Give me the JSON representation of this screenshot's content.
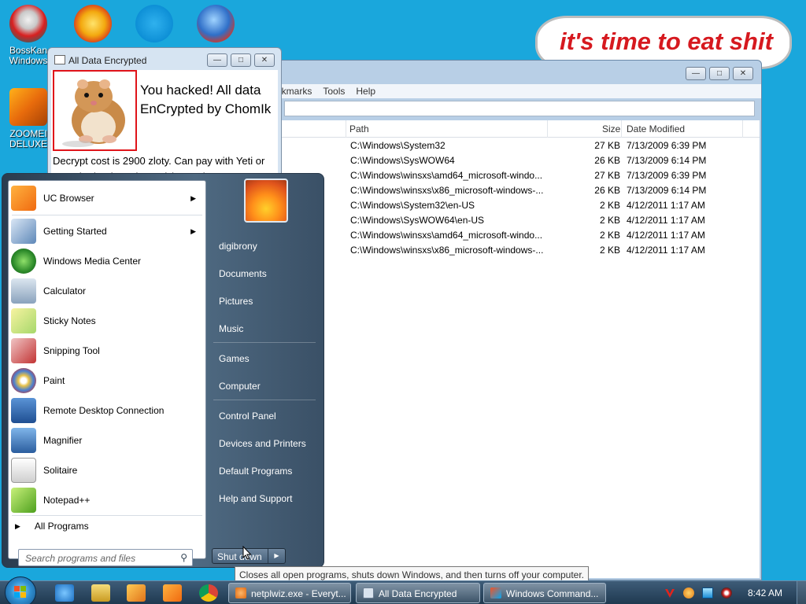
{
  "desktop": {
    "icons": [
      {
        "label": "BossKan Windows"
      },
      {
        "label": ""
      },
      {
        "label": ""
      },
      {
        "label": ""
      },
      {
        "label": "ZOOMEI DELUXE"
      }
    ],
    "bubble_text": "it's time to eat shit"
  },
  "ransom_window": {
    "title": "All Data Encrypted",
    "headline": "You hacked! All data EnCrypted by ChomIk",
    "body": "Decrypt cost is 2900 zloty. Can pay with Yeti or SMS (Poland number only). Send message"
  },
  "explorer": {
    "menu": [
      "okmarks",
      "Tools",
      "Help"
    ],
    "columns": {
      "path": "Path",
      "size": "Size",
      "date": "Date Modified"
    },
    "rows": [
      {
        "path": "C:\\Windows\\System32",
        "size": "27 KB",
        "date": "7/13/2009 6:39 PM"
      },
      {
        "path": "C:\\Windows\\SysWOW64",
        "size": "26 KB",
        "date": "7/13/2009 6:14 PM"
      },
      {
        "path": "C:\\Windows\\winsxs\\amd64_microsoft-windo...",
        "size": "27 KB",
        "date": "7/13/2009 6:39 PM"
      },
      {
        "path": "C:\\Windows\\winsxs\\x86_microsoft-windows-...",
        "size": "26 KB",
        "date": "7/13/2009 6:14 PM"
      },
      {
        "path": "C:\\Windows\\System32\\en-US",
        "size": "2 KB",
        "date": "4/12/2011 1:17 AM"
      },
      {
        "path": "C:\\Windows\\SysWOW64\\en-US",
        "size": "2 KB",
        "date": "4/12/2011 1:17 AM"
      },
      {
        "path": "C:\\Windows\\winsxs\\amd64_microsoft-windo...",
        "size": "2 KB",
        "date": "4/12/2011 1:17 AM"
      },
      {
        "path": "C:\\Windows\\winsxs\\x86_microsoft-windows-...",
        "size": "2 KB",
        "date": "4/12/2011 1:17 AM"
      }
    ]
  },
  "start_menu": {
    "programs": [
      {
        "label": "UC Browser",
        "icon": "uc-browser-icon"
      },
      {
        "label": "Getting Started",
        "icon": "getting-started-icon"
      },
      {
        "label": "Windows Media Center",
        "icon": "media-center-icon"
      },
      {
        "label": "Calculator",
        "icon": "calculator-icon"
      },
      {
        "label": "Sticky Notes",
        "icon": "sticky-notes-icon"
      },
      {
        "label": "Snipping Tool",
        "icon": "snipping-tool-icon"
      },
      {
        "label": "Paint",
        "icon": "paint-icon"
      },
      {
        "label": "Remote Desktop Connection",
        "icon": "remote-desktop-icon"
      },
      {
        "label": "Magnifier",
        "icon": "magnifier-icon"
      },
      {
        "label": "Solitaire",
        "icon": "solitaire-icon"
      },
      {
        "label": "Notepad++",
        "icon": "notepadpp-icon"
      }
    ],
    "all_programs": "All Programs",
    "search_placeholder": "Search programs and files",
    "right": {
      "user": "digibrony",
      "documents": "Documents",
      "pictures": "Pictures",
      "music": "Music",
      "games": "Games",
      "computer": "Computer",
      "control_panel": "Control Panel",
      "devices": "Devices and Printers",
      "default_programs": "Default Programs",
      "help": "Help and Support"
    },
    "shutdown_label": "Shut down",
    "tooltip": "Closes all open programs, shuts down Windows, and then turns off your computer."
  },
  "taskbar": {
    "tasks": [
      {
        "label": "netplwiz.exe - Everyt..."
      },
      {
        "label": "All Data Encrypted"
      },
      {
        "label": "Windows Command..."
      }
    ],
    "clock": "8:42 AM"
  },
  "colors": {
    "desktop_bg": "#1aa7dc",
    "bubble_text": "#d6191f",
    "ransom_border": "#e0141a"
  }
}
